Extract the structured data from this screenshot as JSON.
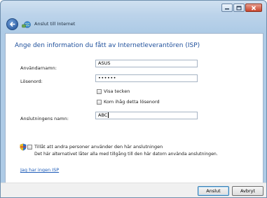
{
  "window": {
    "title": "Anslut till Internet",
    "controls": [
      "minimize-icon",
      "maximize-icon",
      "close-icon"
    ]
  },
  "form": {
    "heading": "Ange den information du fått av Internetleverantören (ISP)",
    "username_label": "Användarnamn:",
    "username_value": "ASUS",
    "password_label": "Lösenord:",
    "password_value": "••••••",
    "show_chars_label": "Visa tecken",
    "remember_password_label": "Kom ihåg detta lösenord",
    "connection_name_label": "Anslutningens namn:",
    "connection_name_value": "ABC",
    "allow_others_label": "Tillåt att andra personer använder den här anslutningen",
    "allow_others_note": "Det här alternativet låter alla med tillgång till den här datorn använda anslutningen.",
    "no_isp_link": "Jag har ingen ISP"
  },
  "footer": {
    "connect_label": "Anslut",
    "cancel_label": "Avbryt"
  },
  "colors": {
    "heading": "#1e4f9b",
    "link": "#1d5bb8",
    "titlebar": "#bcd3ea",
    "close": "#c9452d"
  }
}
